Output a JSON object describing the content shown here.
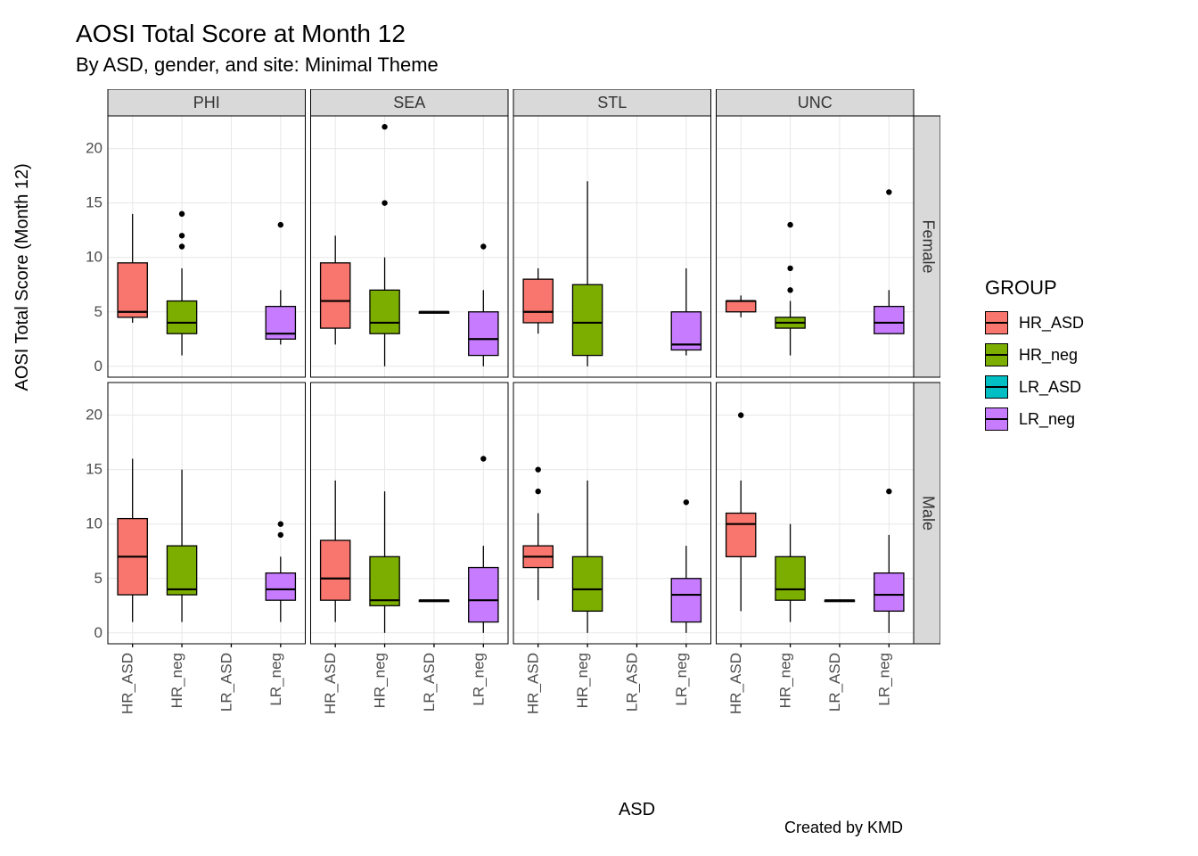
{
  "title": "AOSI Total Score at Month 12",
  "subtitle": "By ASD, gender, and site: Minimal Theme",
  "caption": "Created by KMD",
  "xlabel": "ASD",
  "ylabel": "AOSI Total Score (Month 12)",
  "legend_title": "GROUP",
  "chart_data": {
    "type": "boxplot",
    "facet_cols": [
      "PHI",
      "SEA",
      "STL",
      "UNC"
    ],
    "facet_rows": [
      "Female",
      "Male"
    ],
    "x_categories": [
      "HR_ASD",
      "HR_neg",
      "LR_ASD",
      "LR_neg"
    ],
    "y_ticks": [
      0,
      5,
      10,
      15,
      20
    ],
    "ylim": [
      -1,
      23
    ],
    "colors": {
      "HR_ASD": "#F8766D",
      "HR_neg": "#7CAE00",
      "LR_ASD": "#00BFC4",
      "LR_neg": "#C77CFF"
    },
    "legend_order": [
      "HR_ASD",
      "HR_neg",
      "LR_ASD",
      "LR_neg"
    ],
    "panels": {
      "PHI": {
        "Female": {
          "HR_ASD": {
            "min": 4,
            "q1": 4.5,
            "med": 5,
            "q3": 9.5,
            "max": 14,
            "outliers": []
          },
          "HR_neg": {
            "min": 1,
            "q1": 3,
            "med": 4,
            "q3": 6,
            "max": 9,
            "outliers": [
              11,
              12,
              14
            ]
          },
          "LR_ASD": null,
          "LR_neg": {
            "min": 2,
            "q1": 2.5,
            "med": 3,
            "q3": 5.5,
            "max": 7,
            "outliers": [
              13
            ]
          }
        },
        "Male": {
          "HR_ASD": {
            "min": 1,
            "q1": 3.5,
            "med": 7,
            "q3": 10.5,
            "max": 16,
            "outliers": []
          },
          "HR_neg": {
            "min": 1,
            "q1": 3.5,
            "med": 4,
            "q3": 8,
            "max": 15,
            "outliers": []
          },
          "LR_ASD": null,
          "LR_neg": {
            "min": 1,
            "q1": 3,
            "med": 4,
            "q3": 5.5,
            "max": 7,
            "outliers": [
              9,
              10
            ]
          }
        }
      },
      "SEA": {
        "Female": {
          "HR_ASD": {
            "min": 2,
            "q1": 3.5,
            "med": 6,
            "q3": 9.5,
            "max": 12,
            "outliers": []
          },
          "HR_neg": {
            "min": 0,
            "q1": 3,
            "med": 4,
            "q3": 7,
            "max": 10,
            "outliers": [
              15,
              22
            ]
          },
          "LR_ASD": {
            "min": 5,
            "q1": 5,
            "med": 5,
            "q3": 5,
            "max": 5,
            "outliers": []
          },
          "LR_neg": {
            "min": 0,
            "q1": 1,
            "med": 2.5,
            "q3": 5,
            "max": 7,
            "outliers": [
              11
            ]
          }
        },
        "Male": {
          "HR_ASD": {
            "min": 1,
            "q1": 3,
            "med": 5,
            "q3": 8.5,
            "max": 14,
            "outliers": []
          },
          "HR_neg": {
            "min": 0,
            "q1": 2.5,
            "med": 3,
            "q3": 7,
            "max": 13,
            "outliers": []
          },
          "LR_ASD": {
            "min": 3,
            "q1": 3,
            "med": 3,
            "q3": 3,
            "max": 3,
            "outliers": []
          },
          "LR_neg": {
            "min": 0,
            "q1": 1,
            "med": 3,
            "q3": 6,
            "max": 8,
            "outliers": [
              16
            ]
          }
        }
      },
      "STL": {
        "Female": {
          "HR_ASD": {
            "min": 3,
            "q1": 4,
            "med": 5,
            "q3": 8,
            "max": 9,
            "outliers": []
          },
          "HR_neg": {
            "min": 0,
            "q1": 1,
            "med": 4,
            "q3": 7.5,
            "max": 17,
            "outliers": []
          },
          "LR_ASD": null,
          "LR_neg": {
            "min": 1,
            "q1": 1.5,
            "med": 2,
            "q3": 5,
            "max": 9,
            "outliers": []
          }
        },
        "Male": {
          "HR_ASD": {
            "min": 3,
            "q1": 6,
            "med": 7,
            "q3": 8,
            "max": 11,
            "outliers": [
              13,
              15
            ]
          },
          "HR_neg": {
            "min": 0,
            "q1": 2,
            "med": 4,
            "q3": 7,
            "max": 14,
            "outliers": []
          },
          "LR_ASD": null,
          "LR_neg": {
            "min": 0,
            "q1": 1,
            "med": 3.5,
            "q3": 5,
            "max": 8,
            "outliers": [
              12
            ]
          }
        }
      },
      "UNC": {
        "Female": {
          "HR_ASD": {
            "min": 4.5,
            "q1": 5,
            "med": 6,
            "q3": 6,
            "max": 6.5,
            "outliers": []
          },
          "HR_neg": {
            "min": 1,
            "q1": 3.5,
            "med": 4,
            "q3": 4.5,
            "max": 6,
            "outliers": [
              7,
              9,
              13
            ]
          },
          "LR_ASD": null,
          "LR_neg": {
            "min": 3,
            "q1": 3,
            "med": 4,
            "q3": 5.5,
            "max": 7,
            "outliers": [
              16
            ]
          }
        },
        "Male": {
          "HR_ASD": {
            "min": 2,
            "q1": 7,
            "med": 10,
            "q3": 11,
            "max": 14,
            "outliers": [
              20
            ]
          },
          "HR_neg": {
            "min": 1,
            "q1": 3,
            "med": 4,
            "q3": 7,
            "max": 10,
            "outliers": []
          },
          "LR_ASD": {
            "min": 3,
            "q1": 3,
            "med": 3,
            "q3": 3,
            "max": 3,
            "outliers": []
          },
          "LR_neg": {
            "min": 0,
            "q1": 2,
            "med": 3.5,
            "q3": 5.5,
            "max": 9,
            "outliers": [
              13
            ]
          }
        }
      }
    }
  }
}
